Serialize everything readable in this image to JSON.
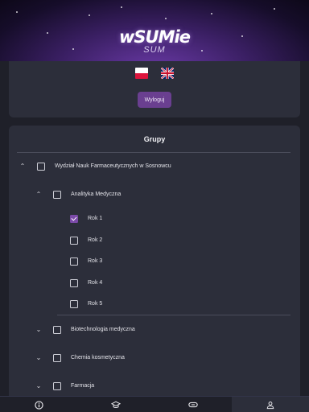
{
  "header": {
    "logo_text": "wSUMie",
    "logo_sub": "SUM"
  },
  "top_card": {
    "logout_label": "Wyloguj",
    "flags": [
      {
        "name": "Polish",
        "icon": "flag-pl-icon"
      },
      {
        "name": "English",
        "icon": "flag-uk-icon"
      }
    ]
  },
  "groups": {
    "title": "Grupy",
    "faculty": {
      "label": "Wydział Nauk Farmaceutycznych w Sosnowcu",
      "expanded": true,
      "checked": false
    },
    "programs": [
      {
        "label": "Analityka Medyczna",
        "expanded": true,
        "checked": false,
        "years": [
          {
            "label": "Rok 1",
            "checked": true
          },
          {
            "label": "Rok 2",
            "checked": false
          },
          {
            "label": "Rok 3",
            "checked": false
          },
          {
            "label": "Rok 4",
            "checked": false
          },
          {
            "label": "Rok 5",
            "checked": false
          }
        ]
      },
      {
        "label": "Biotechnologia medyczna",
        "expanded": false,
        "checked": false
      },
      {
        "label": "Chemia kosmetyczna",
        "expanded": false,
        "checked": false
      },
      {
        "label": "Farmacja",
        "expanded": false,
        "checked": false
      }
    ]
  },
  "bottom_nav": {
    "items": [
      {
        "icon": "info-icon",
        "active": false
      },
      {
        "icon": "graduation-cap-icon",
        "active": false
      },
      {
        "icon": "link-icon",
        "active": false
      },
      {
        "icon": "person-icon",
        "active": true
      }
    ]
  },
  "colors": {
    "background": "#1f2029",
    "card": "#2c2e3a",
    "accent": "#7b4aa8",
    "button": "#6a3f90"
  }
}
